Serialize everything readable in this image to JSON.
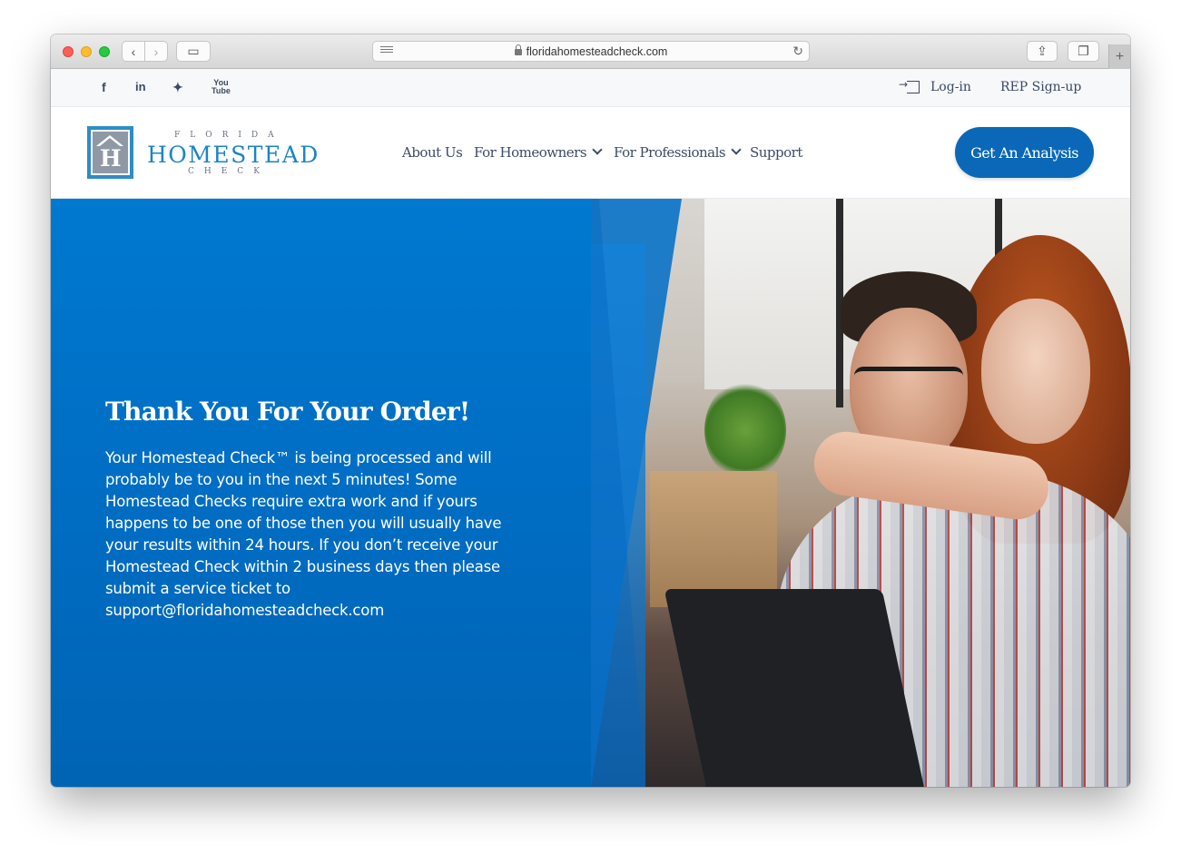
{
  "browser": {
    "url": "floridahomesteadcheck.com"
  },
  "topbar": {
    "social": [
      {
        "icon": "facebook-icon",
        "glyph": "f"
      },
      {
        "icon": "linkedin-icon",
        "glyph": "in"
      },
      {
        "icon": "twitter-icon",
        "glyph": "🐦"
      },
      {
        "icon": "youtube-icon",
        "glyph": "You Tube"
      }
    ],
    "login_label": "Log-in",
    "rep_signup_label": "REP Sign-up"
  },
  "logo": {
    "top": "FLORIDA",
    "main": "HOMESTEAD",
    "bottom": "CHECK"
  },
  "nav": {
    "about": "About Us",
    "homeowners": "For Homeowners",
    "professionals": "For Professionals",
    "support": "Support"
  },
  "cta": {
    "label": "Get An Analysis"
  },
  "hero": {
    "title": "Thank You For Your Order!",
    "body": "Your Homestead Check™ is being processed and will probably be to you in the next 5 minutes! Some Homestead Checks require extra work and if yours happens to be one of those then you will usually have your results within 24 hours. If you don’t receive your Homestead Check within 2 business days then please submit a service ticket to support@floridahomesteadcheck.com"
  },
  "colors": {
    "brand_blue": "#0b68b8",
    "hero_blue": "#0079d0",
    "nav_text": "#3d4b66"
  }
}
